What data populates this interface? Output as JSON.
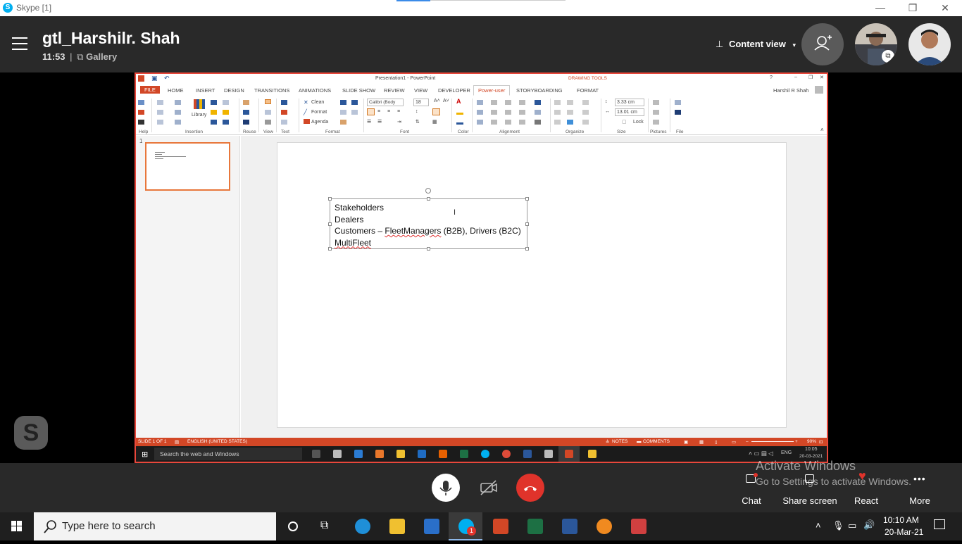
{
  "skype_window": {
    "title": "Skype [1]",
    "controls": {
      "minimize": "—",
      "maximize": "❐",
      "close": "✕"
    }
  },
  "call_header": {
    "name": "gtl_Harshilr. Shah",
    "duration": "11:53",
    "separator": "|",
    "view_mode": "Gallery",
    "content_view_label": "Content view"
  },
  "ppt": {
    "window_title": "Presentation1 - PowerPoint",
    "contextual_group": "DRAWING TOOLS",
    "user": "Harshil R Shah",
    "tabs": [
      "FILE",
      "HOME",
      "INSERT",
      "DESIGN",
      "TRANSITIONS",
      "ANIMATIONS",
      "SLIDE SHOW",
      "REVIEW",
      "VIEW",
      "DEVELOPER",
      "Power-user",
      "STORYBOARDING",
      "FORMAT"
    ],
    "active_tab": "Power-user",
    "ribbon": {
      "groups": [
        "Help",
        "Insertion",
        "Reuse",
        "View",
        "Text",
        "Format",
        "Font",
        "Color",
        "Alignment",
        "Organize",
        "Size",
        "Pictures",
        "File"
      ],
      "library_label": "Library",
      "clean_label": "Clean",
      "format_label": "Format",
      "agenda_label": "Agenda",
      "font_name": "Calibri (Body",
      "font_size": "18",
      "height_value": "3.33 cm",
      "width_value": "13.01 cm",
      "lock_label": "Lock"
    },
    "slide_number": "1",
    "textbox_lines": {
      "line1": "Stakeholders",
      "line2": "Dealers",
      "line3_prefix": "Customers – ",
      "line3_misspelled": "FleetManagers",
      "line3_suffix": " (B2B), Drivers (B2C)",
      "line4": "MultiFleet"
    },
    "status": {
      "slide_of": "SLIDE 1 OF 1",
      "language": "ENGLISH (UNITED STATES)",
      "notes": "NOTES",
      "comments": "COMMENTS",
      "zoom": "90%"
    },
    "inner_taskbar": {
      "search_placeholder": "Search the web and Windows",
      "lang": "ENG",
      "time": "10:05",
      "date": "20-03-2021"
    }
  },
  "call_controls": {
    "chat_label": "Chat",
    "share_label": "Share screen",
    "react_label": "React",
    "more_label": "More",
    "watermark_line1": "Activate Windows",
    "watermark_line2": "Go to Settings to activate Windows."
  },
  "taskbar": {
    "search_placeholder": "Type here to search",
    "time": "10:10 AM",
    "date": "20-Mar-21",
    "skype_badge": "1"
  },
  "colors": {
    "skype_blue": "#00aff0",
    "share_border": "#e8473b",
    "ppt_orange": "#d24726",
    "end_call_red": "#e0332b"
  }
}
